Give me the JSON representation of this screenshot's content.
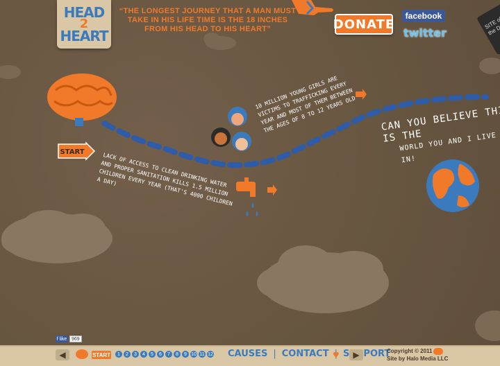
{
  "logo": {
    "line1": "HEAD",
    "line2": "2",
    "line3": "HEART"
  },
  "quote": "“THE LONGEST JOURNEY THAT A MAN MUST TAKE IN HIS LIFE TIME IS THE 18 INCHES FROM HIS HEAD TO HIS HEART”",
  "donate_label": "DONATE",
  "social": {
    "facebook": "facebook",
    "twitter": "twitter"
  },
  "sotd": {
    "line1": "SITE of",
    "line2": "the DAY"
  },
  "story": {
    "start_label": "START",
    "girls": "10 Million young girls are victims to trafficking every year and most of them between the ages of 8 to 12 years old",
    "water": "Lack of access to clean drinking water and proper sanitation kills 1.5 million children every year (that's 4000 children a day)",
    "believe_main": "CAN YOU BELIEVE THIS IS THE",
    "believe_sub": "WORLD YOU AND I LIVE IN!"
  },
  "footer": {
    "fb_label": "f like",
    "fb_count": "969",
    "start_label": "START",
    "pages": [
      "1",
      "2",
      "3",
      "4",
      "5",
      "6",
      "7",
      "8",
      "9",
      "10",
      "11",
      "12"
    ],
    "links": [
      "CAUSES",
      "CONTACT",
      "SUPPORT"
    ],
    "copyright": "Copyright © 2011",
    "site_by": "Site by Halo Media LLC"
  },
  "colors": {
    "orange": "#f07a2a",
    "blue": "#3b7bbd",
    "background": "#6b5a47",
    "paper": "#d8c6a5"
  }
}
